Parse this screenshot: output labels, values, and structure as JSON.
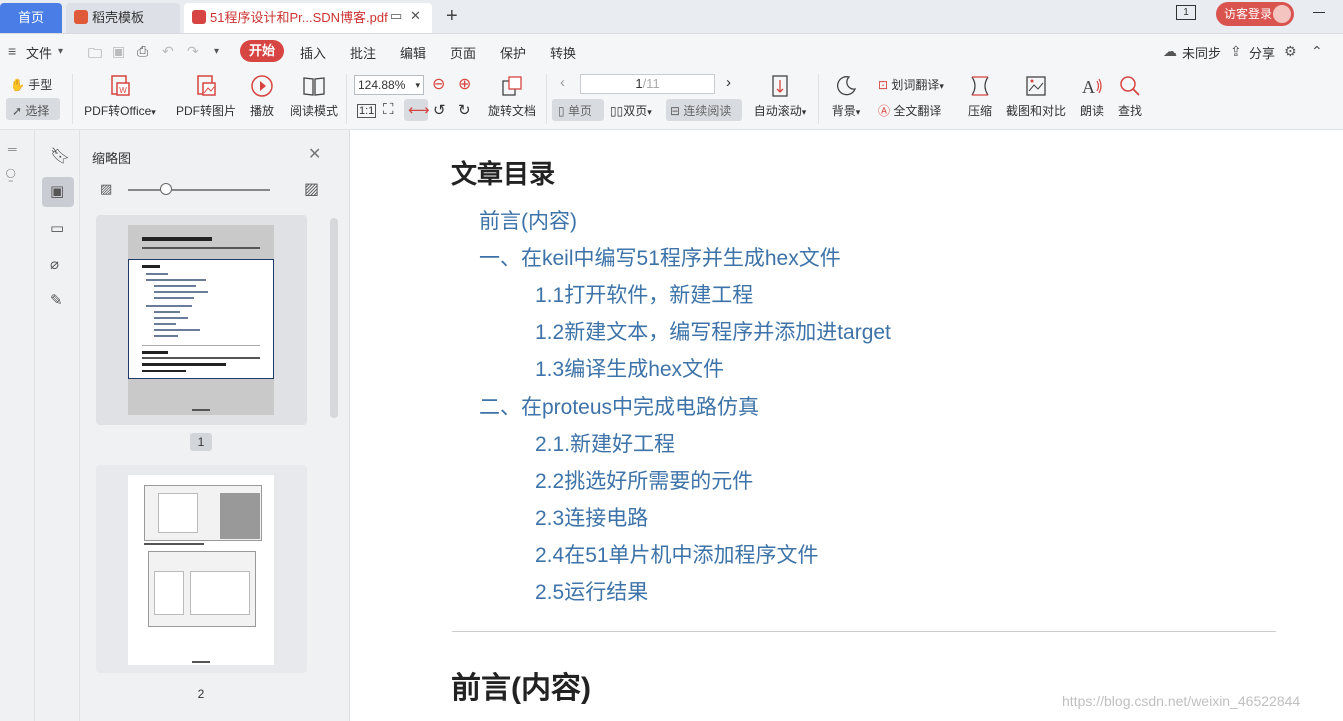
{
  "tabs": {
    "home": "首页",
    "template": "稻壳模板",
    "active_doc": "51程序设计和Pr...SDN博客.pdf",
    "page_indicator": "1",
    "login": "访客登录"
  },
  "menu": {
    "file": "文件",
    "start": "开始",
    "insert": "插入",
    "annotate": "批注",
    "edit": "编辑",
    "page": "页面",
    "protect": "保护",
    "convert": "转换",
    "sync": "未同步",
    "share": "分享"
  },
  "toolbar": {
    "hand": "手型",
    "select": "选择",
    "pdf_to_office": "PDF转Office",
    "pdf_to_image": "PDF转图片",
    "play": "播放",
    "read_mode": "阅读模式",
    "zoom": "124.88%",
    "page_current": "1",
    "page_total": "/11",
    "rotate_doc": "旋转文档",
    "single_page": "单页",
    "double_page": "双页",
    "continuous": "连续阅读",
    "auto_scroll": "自动滚动",
    "background": "背景",
    "word_translate": "划词翻译",
    "full_translate": "全文翻译",
    "compress": "压缩",
    "screenshot_compare": "截图和对比",
    "read_aloud": "朗读",
    "find": "查找"
  },
  "thumbnails": {
    "title": "缩略图",
    "pages": [
      {
        "number": "1",
        "selected": true
      },
      {
        "number": "2",
        "selected": false
      }
    ]
  },
  "document": {
    "toc_title": "文章目录",
    "toc": [
      "前言(内容)",
      "一、在keil中编写51程序并生成hex文件",
      "1.1打开软件，新建工程",
      "1.2新建文本，编写程序并添加进target",
      "1.3编译生成hex文件",
      "二、在proteus中完成电路仿真",
      "2.1.新建好工程",
      "2.2挑选好所需要的元件",
      "2.3连接电路",
      "2.4在51单片机中添加程序文件",
      "2.5运行结果"
    ],
    "section_heading": "前言(内容)",
    "watermark": "https://blog.csdn.net/weixin_46522844"
  },
  "colors": {
    "accent": "#d64541",
    "home_tab": "#4a7ee6",
    "toc_link": "#3d73a8"
  }
}
